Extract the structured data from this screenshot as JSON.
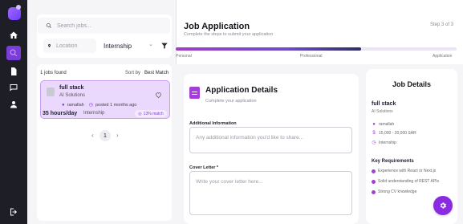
{
  "sidebar": {
    "items": [
      {
        "icon": "logo-icon"
      },
      {
        "icon": "home-icon"
      },
      {
        "icon": "search-icon",
        "active": true
      },
      {
        "icon": "document-icon"
      },
      {
        "icon": "chat-icon"
      },
      {
        "icon": "user-icon"
      },
      {
        "icon": "logout-icon"
      }
    ]
  },
  "filters": {
    "search_placeholder": "Search jobs...",
    "location_placeholder": "Location",
    "job_type": "Internship"
  },
  "results": {
    "count_text": "1 jobs found",
    "sort_label": "Sort by",
    "sort_value": "Best Match"
  },
  "job": {
    "title": "full stack",
    "company": "AI Solutions",
    "location": "ramallah",
    "posted": "posted 1 months ago",
    "hours": "35 hours/day",
    "type": "Internship",
    "match": "13% match"
  },
  "pagination": {
    "prev": "‹",
    "page": "1",
    "next": "›"
  },
  "header": {
    "title": "Job Application",
    "subtitle": "Complete the steps to submit your application",
    "step": "Step 3 of 3"
  },
  "progress": {
    "fraction": 0.66,
    "steps": [
      "Personal",
      "Professional",
      "Application"
    ]
  },
  "form": {
    "title": "Application Details",
    "subtitle": "Complete your application",
    "additional_label": "Additional Information",
    "additional_placeholder": "Any additional information you'd like to share...",
    "cover_label": "Cover Letter *",
    "cover_placeholder": "Write your cover letter here..."
  },
  "details": {
    "title": "Job Details",
    "job_title": "full stack",
    "company": "AI Solutions",
    "location": "ramallah",
    "salary": "15,000 - 20,000 SAR",
    "type": "Internship",
    "requirements_title": "Key Requirements",
    "requirements": [
      "Experience with React or Next.js",
      "Solid understanding of REST APIs",
      "Strong CV knowledge"
    ]
  },
  "colors": {
    "accent": "#8a2be2",
    "card_bg": "#ebd9fd",
    "sidebar_bg": "#1e1e26"
  }
}
